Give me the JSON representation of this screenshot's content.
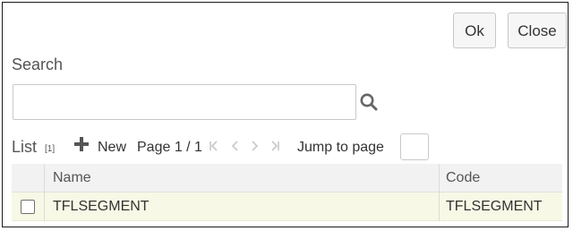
{
  "dialog": {
    "ok_label": "Ok",
    "close_label": "Close"
  },
  "search": {
    "label": "Search",
    "value": "",
    "placeholder": ""
  },
  "list": {
    "label": "List",
    "count": "[1]",
    "new_label": "New",
    "page_info": "Page 1 / 1",
    "nav": {
      "first": "≤",
      "prev": "‹",
      "next": "›",
      "last": "≥"
    },
    "jump_label": "Jump to page",
    "jump_value": ""
  },
  "table": {
    "columns": [
      "Name",
      "Code"
    ],
    "rows": [
      {
        "name": "TFLSEGMENT",
        "code": "TFLSEGMENT",
        "checked": false
      }
    ]
  },
  "colors": {
    "selected_row_bg": "#f8f8e6",
    "header_bg": "#f2f2f2",
    "disabled_nav": "#c8c8c8"
  }
}
